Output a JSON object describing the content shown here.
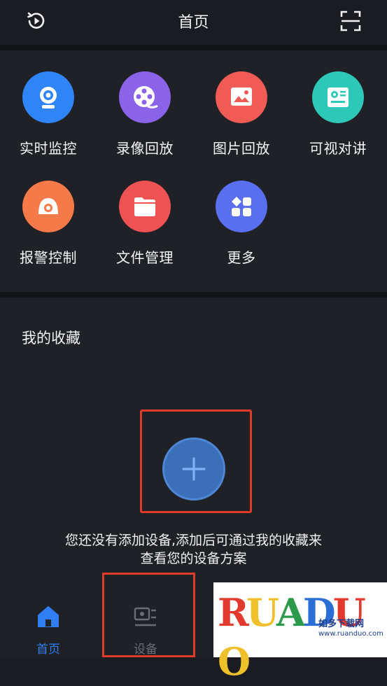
{
  "header": {
    "title": "首页",
    "left_icon": "history-replay-icon",
    "right_icon": "scan-icon"
  },
  "features": [
    {
      "label": "实时监控",
      "icon": "camera-icon",
      "color": "#2f84f6"
    },
    {
      "label": "录像回放",
      "icon": "film-reel-icon",
      "color": "#8a63e8"
    },
    {
      "label": "图片回放",
      "icon": "image-icon",
      "color": "#f05c55"
    },
    {
      "label": "可视对讲",
      "icon": "intercom-icon",
      "color": "#2ec8b8"
    },
    {
      "label": "报警控制",
      "icon": "alarm-icon",
      "color": "#f47a4a"
    },
    {
      "label": "文件管理",
      "icon": "folder-icon",
      "color": "#ee5252"
    },
    {
      "label": "更多",
      "icon": "more-apps-icon",
      "color": "#5a6ff0"
    }
  ],
  "favorites": {
    "title": "我的收藏",
    "empty_text_line1": "您还没有添加设备,添加后可通过我的收藏来",
    "empty_text_line2": "查看您的设备方案"
  },
  "tabs": [
    {
      "label": "首页",
      "icon": "home-icon",
      "active": true
    },
    {
      "label": "设备",
      "icon": "device-icon",
      "active": false
    }
  ],
  "watermark": {
    "letters": "RUANDUO",
    "cn_text": "如多下载网",
    "url": "www.ruanduo.com"
  }
}
